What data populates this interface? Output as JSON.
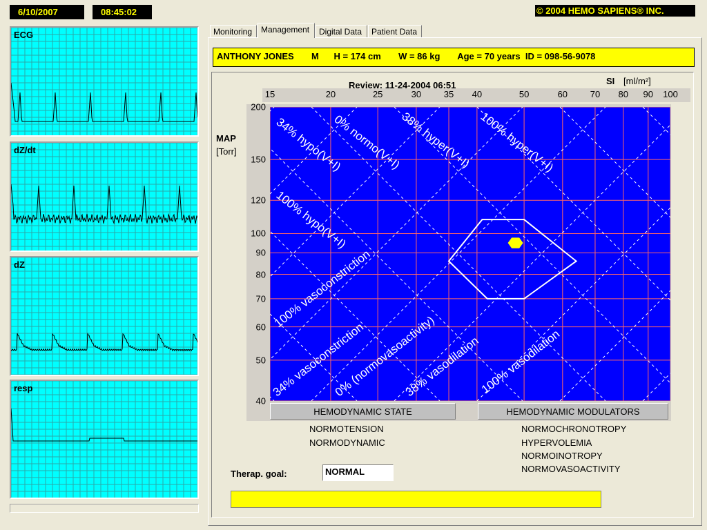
{
  "header": {
    "date": "6/10/2007",
    "time": "08:45:02",
    "copyright": "© 2004 HEMO SAPIENS® INC."
  },
  "waveforms": [
    {
      "label": "ECG"
    },
    {
      "label": "dZ/dt"
    },
    {
      "label": "dZ"
    },
    {
      "label": "resp"
    }
  ],
  "tabs": [
    {
      "label": "Monitoring",
      "active": false
    },
    {
      "label": "Management",
      "active": true
    },
    {
      "label": "Digital Data",
      "active": false
    },
    {
      "label": "Patient Data",
      "active": false
    }
  ],
  "patient": {
    "info": "ANTHONY JONES       M      H = 174 cm       W = 86 kg       Age = 70 years  ID = 098-56-9078"
  },
  "chart_data": {
    "type": "scatter",
    "title": "Review: 11-24-2004 06:51",
    "xlabel": "SI",
    "xunit": "[ml/m²]",
    "ylabel": "MAP",
    "yunit": "[Torr]",
    "x_scale": "log",
    "y_scale": "log",
    "xlim": [
      15,
      100
    ],
    "ylim": [
      40,
      200
    ],
    "x_ticks": [
      15,
      20,
      25,
      30,
      35,
      40,
      50,
      60,
      70,
      80,
      90,
      100
    ],
    "y_ticks": [
      200,
      150,
      120,
      100,
      90,
      80,
      70,
      60,
      50,
      40
    ],
    "background_color": "#0000ff",
    "grid_color": "#ff6666",
    "marker": {
      "x": 48,
      "y": 95,
      "color": "#ffff00"
    },
    "normal_region": [
      {
        "x": 41,
        "y": 108
      },
      {
        "x": 50,
        "y": 108
      },
      {
        "x": 64,
        "y": 86
      },
      {
        "x": 50,
        "y": 70
      },
      {
        "x": 42,
        "y": 70
      },
      {
        "x": 35,
        "y": 86
      }
    ],
    "iso_lines_label_up": [
      "34% hypo(V+I)",
      "0% normo(V+I)",
      "38% hyper(V+I)",
      "100% hyper(V+I)",
      "100% hypo(V+I)"
    ],
    "iso_lines_label_down": [
      "100% vasoconstriction",
      "34% vasoconstriction",
      "0% (normovasoactivity)",
      "38% vasodilation",
      "100% vasodilation"
    ]
  },
  "hemodynamic_state": {
    "title": "HEMODYNAMIC STATE",
    "items": [
      "NORMOTENSION",
      "NORMODYNAMIC"
    ]
  },
  "hemodynamic_modulators": {
    "title": "HEMODYNAMIC MODULATORS",
    "items": [
      "NORMOCHRONOTROPY",
      "HYPERVOLEMIA",
      "NORMOINOTROPY",
      "NORMOVASOACTIVITY"
    ]
  },
  "therapy": {
    "label": "Therap. goal:",
    "value": "NORMAL"
  }
}
